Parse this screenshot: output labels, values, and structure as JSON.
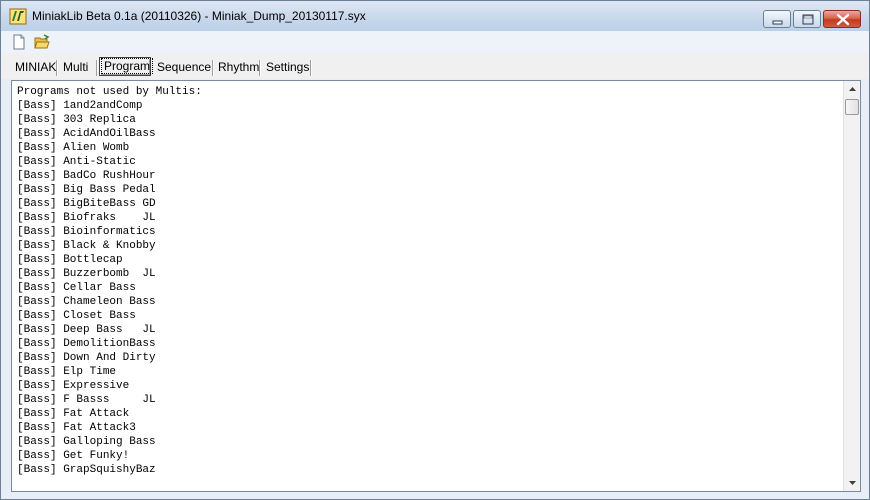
{
  "window": {
    "title": "MiniakLib Beta 0.1a (20110326) - Miniak_Dump_20130117.syx",
    "icon": "miniak-app-icon"
  },
  "toolbar": {
    "new_icon": "new-document-icon",
    "open_icon": "open-folder-icon"
  },
  "tabs": [
    {
      "label": "MINIAK",
      "selected": false
    },
    {
      "label": "Multi",
      "selected": false
    },
    {
      "label": "Program",
      "selected": true
    },
    {
      "label": "Sequence",
      "selected": false
    },
    {
      "label": "Rhythm",
      "selected": false
    },
    {
      "label": "Settings",
      "selected": false
    }
  ],
  "content": {
    "lines": [
      "Programs not used by Multis:",
      "[Bass] 1and2andComp",
      "[Bass] 303 Replica",
      "[Bass] AcidAndOilBass",
      "[Bass] Alien Womb",
      "[Bass] Anti-Static",
      "[Bass] BadCo RushHour",
      "[Bass] Big Bass Pedal",
      "[Bass] BigBiteBass GD",
      "[Bass] Biofraks    JL",
      "[Bass] Bioinformatics",
      "[Bass] Black & Knobby",
      "[Bass] Bottlecap",
      "[Bass] Buzzerbomb  JL",
      "[Bass] Cellar Bass",
      "[Bass] Chameleon Bass",
      "[Bass] Closet Bass",
      "[Bass] Deep Bass   JL",
      "[Bass] DemolitionBass",
      "[Bass] Down And Dirty",
      "[Bass] Elp Time",
      "[Bass] Expressive",
      "[Bass] F Basss     JL",
      "[Bass] Fat Attack",
      "[Bass] Fat Attack3",
      "[Bass] Galloping Bass",
      "[Bass] Get Funky!",
      "[Bass] GrapSquishyBaz"
    ]
  }
}
